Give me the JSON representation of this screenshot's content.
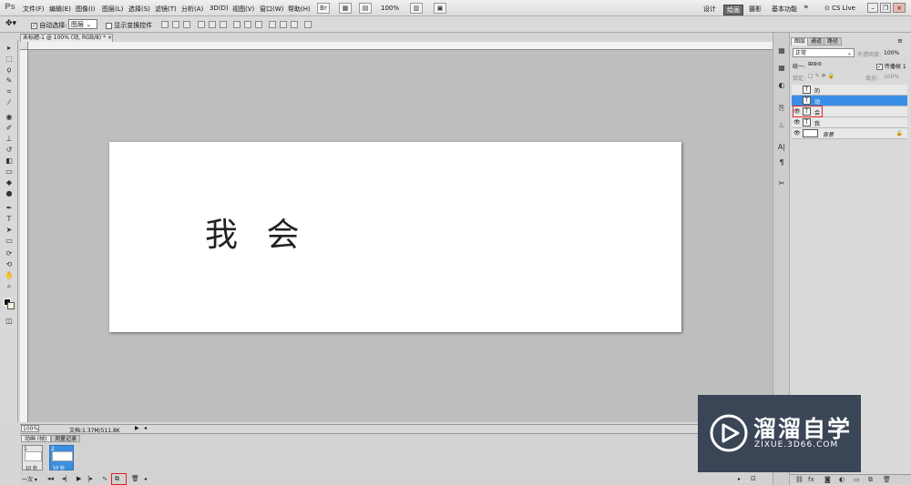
{
  "app": {
    "logo": "Ps"
  },
  "menus": [
    "文件(F)",
    "编辑(E)",
    "图像(I)",
    "图层(L)",
    "选择(S)",
    "滤镜(T)",
    "分析(A)",
    "3D(D)",
    "视图(V)",
    "窗口(W)",
    "帮助(H)"
  ],
  "menubar": {
    "zoom": "100%",
    "workspaces": [
      "设计",
      "绘画",
      "摄影",
      "基本功能"
    ],
    "more": "»",
    "cs_live": "CS Live"
  },
  "options": {
    "auto_select_label": "自动选择:",
    "auto_select_target": "图层",
    "show_transform_label": "显示变换控件"
  },
  "document": {
    "tab_title": "未标题-1 @ 100% (动, RGB/8) *",
    "canvas_text": "我 会",
    "zoom": "100%",
    "doc_info": "文档:1.37M/511.8K"
  },
  "timeline": {
    "tabs": [
      "动画 (帧)",
      "测量记录"
    ],
    "frames": [
      {
        "num": "1",
        "delay": "10 秒"
      },
      {
        "num": "2",
        "delay": "10 秒"
      }
    ],
    "loop": "一次"
  },
  "layers_panel": {
    "tabs": [
      "图层",
      "通道",
      "路径"
    ],
    "blend_mode": "正常",
    "opacity_label": "不透明度:",
    "opacity": "100%",
    "lock_label": "锁定:",
    "unify_label": "统一:",
    "propagate_label": "传播帧 1",
    "fill_label": "填充:",
    "fill": "100%",
    "layers": [
      {
        "name": "的",
        "type": "T",
        "visible": false,
        "selected": false
      },
      {
        "name": "动",
        "type": "T",
        "visible": false,
        "selected": true
      },
      {
        "name": "会",
        "type": "T",
        "visible": true,
        "selected": false
      },
      {
        "name": "我",
        "type": "T",
        "visible": true,
        "selected": false
      },
      {
        "name": "背景",
        "type": "bg",
        "visible": true,
        "selected": false
      }
    ]
  },
  "watermark": {
    "title": "溜溜自学",
    "url": "ZIXUE.3D66.COM"
  },
  "colors": {
    "accent": "#3a8ee6",
    "highlight": "#e02020",
    "watermark_bg": "#3a4556"
  }
}
